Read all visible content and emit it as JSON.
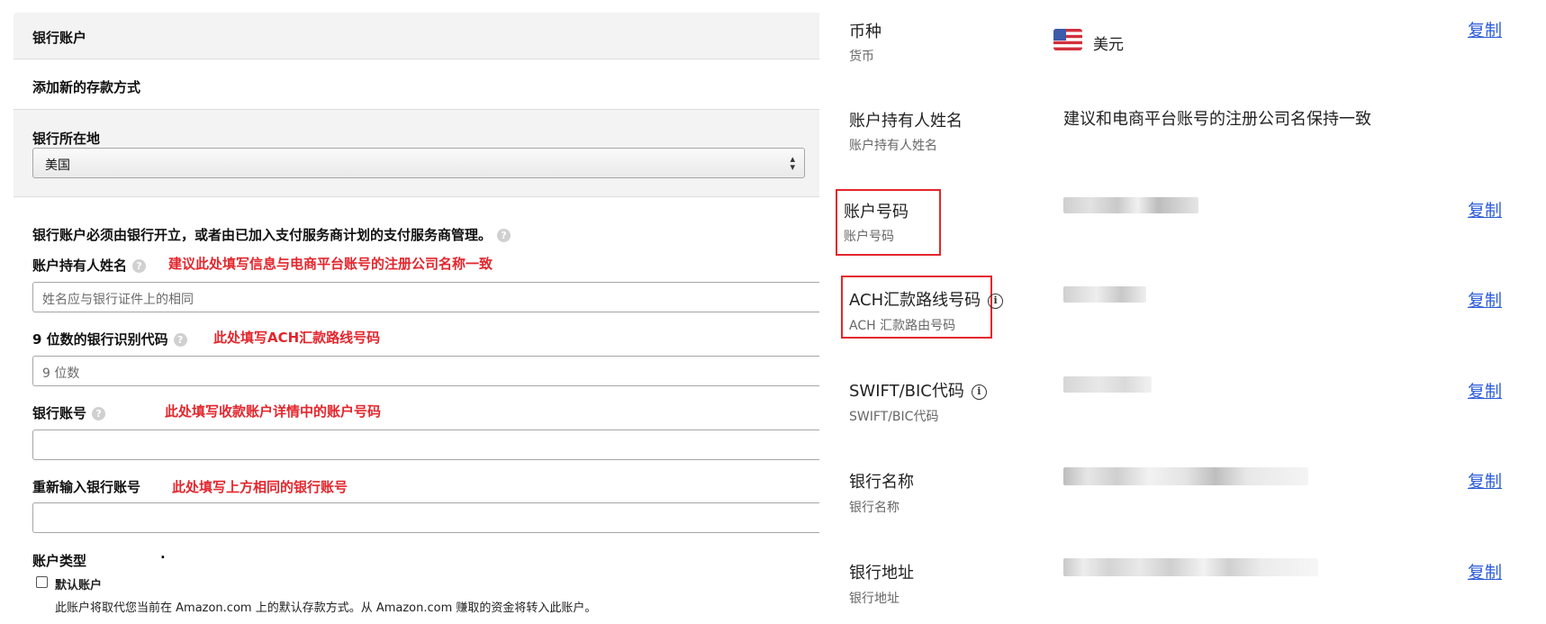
{
  "left": {
    "section_title": "银行账户",
    "add_method": "添加新的存款方式",
    "bank_location_label": "银行所在地",
    "bank_location_value": "美国",
    "notice": "银行账户必须由银行开立，或者由已加入支付服务商计划的支付服务商管理。",
    "holder_label": "账户持有人姓名",
    "holder_annotation": "建议此处填写信息与电商平台账号的注册公司名称一致",
    "holder_placeholder": "姓名应与银行证件上的相同",
    "routing_label": "9 位数的银行识别代码",
    "routing_annotation": "此处填写ACH汇款路线号码",
    "routing_placeholder": "9 位数",
    "account_label": "银行账号",
    "account_annotation": "此处填写收款账户详情中的账户号码",
    "reenter_label": "重新输入银行账号",
    "reenter_annotation": "此处填写上方相同的银行账号",
    "type_label": "账户类型",
    "type_dot": "·",
    "default_label": "默认账户",
    "default_note": "此账户将取代您当前在 Amazon.com 上的默认存款方式。从 Amazon.com 赚取的资金将转入此账户。"
  },
  "right": {
    "copy_label": "复制",
    "rows": [
      {
        "label": "币种",
        "sub": "货币",
        "value": "美元"
      },
      {
        "label": "账户持有人姓名",
        "sub": "账户持有人姓名",
        "value": "建议和电商平台账号的注册公司名保持一致"
      },
      {
        "label": "账户号码",
        "sub": "账户号码",
        "value": ""
      },
      {
        "label": "ACH汇款路线号码",
        "sub": "ACH 汇款路由号码",
        "value": ""
      },
      {
        "label": "SWIFT/BIC代码",
        "sub": "SWIFT/BIC代码",
        "value": ""
      },
      {
        "label": "银行名称",
        "sub": "银行名称",
        "value": ""
      },
      {
        "label": "银行地址",
        "sub": "银行地址",
        "value": ""
      }
    ]
  },
  "colors": {
    "annotation": "#e3262d",
    "link": "#2d5cd8"
  }
}
